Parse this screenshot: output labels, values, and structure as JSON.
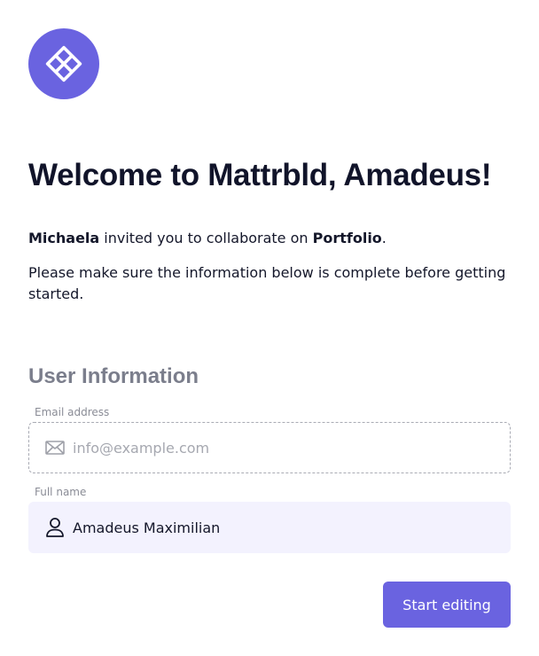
{
  "brand": {
    "accent_color": "#6a63e0",
    "logo_icon": "diamond-grid-logo-icon"
  },
  "welcome": {
    "title": "Welcome to Mattrbld, Amadeus!",
    "inviter": "Michaela",
    "invite_text": " invited you to collaborate on ",
    "project": "Portfolio",
    "period": ".",
    "note": "Please make sure the information below is complete before getting started."
  },
  "user_info": {
    "section_title": "User Information",
    "email": {
      "label": "Email address",
      "placeholder": "info@example.com",
      "value": "",
      "icon": "mail-icon"
    },
    "full_name": {
      "label": "Full name",
      "placeholder": "",
      "value": "Amadeus Maximilian",
      "icon": "user-icon"
    }
  },
  "actions": {
    "start_label": "Start editing"
  }
}
